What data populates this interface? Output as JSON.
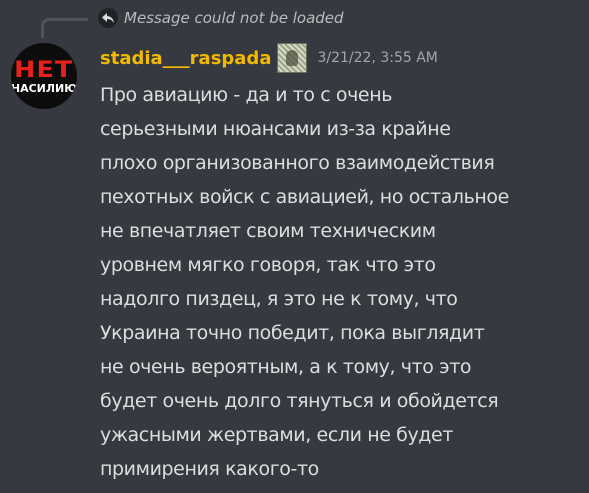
{
  "reply": {
    "text": "Message could not be loaded",
    "icon": "reply-arrow-icon"
  },
  "avatar": {
    "top_text": "НЕТ",
    "bottom_text": "НАСИЛИЮ",
    "colors": {
      "background": "#0c0c0c",
      "top": "#e8211d",
      "bottom": "#ffffff"
    }
  },
  "message": {
    "username": "stadia___raspada",
    "username_color": "#f2b900",
    "timestamp": "3/21/22, 3:55 AM",
    "role_icon": "role-icon",
    "lines": [
      "Про авиацию - да и то с очень",
      "серьезными нюансами из-за крайне",
      "плохо организованного взаимодействия",
      "пехотных войск с авиацией, но остальное",
      "не впечатляет своим техническим",
      "уровнем мягко говоря, так что это",
      "надолго пиздец, я это не к тому, что",
      "Украина точно победит, пока выглядит",
      "не очень вероятным, а к тому, что это",
      "будет очень долго тянуться и обойдется",
      "ужасными жертвами, если не будет",
      "примирения какого-то"
    ]
  },
  "theme": {
    "background": "#36393f",
    "text": "#dcddde",
    "muted": "#a3a6aa"
  }
}
